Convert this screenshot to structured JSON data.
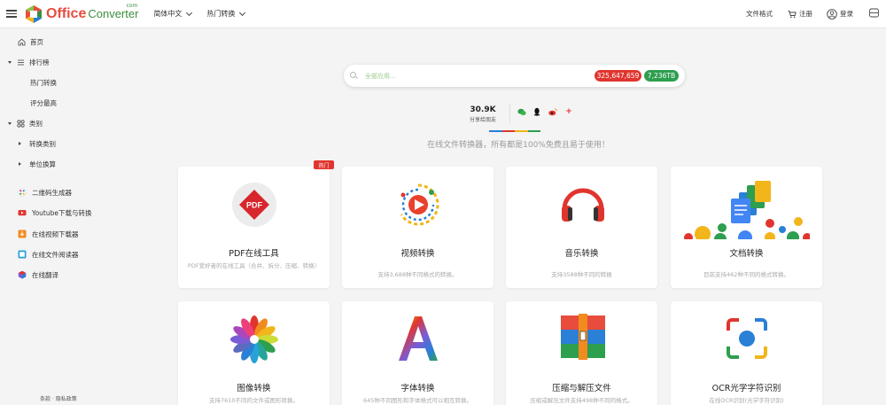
{
  "header": {
    "logo_office": "Office",
    "logo_converter": "Converter",
    "logo_com": "com",
    "language": "简体中文",
    "hot_convert": "热门转换",
    "file_formats": "文件格式",
    "register": "注册",
    "login": "登录"
  },
  "sidebar": {
    "home": "首页",
    "ranking": "排行榜",
    "hot_convert": "热门转换",
    "top_rated": "评分最高",
    "category": "类别",
    "convert_category": "转换类别",
    "unit_convert": "单位换算",
    "qr_generator": "二维码生成器",
    "youtube": "Youtube下载与转换",
    "video_downloader": "在线视频下载器",
    "file_reader": "在线文件阅读器",
    "translate": "在线翻译",
    "footer": "条款 · 隐私政策"
  },
  "search": {
    "placeholder": "全部应用...",
    "count_files": "325,647,659",
    "count_size": "7,236TB"
  },
  "share": {
    "count": "30.9K",
    "label": "分享给朋友",
    "plus": "+"
  },
  "tagline": "在线文件转换器，所有都是100%免费且易于使用！",
  "hot_badge": "热门",
  "cards": [
    {
      "title": "PDF在线工具",
      "desc": "PDF爱好者的在线工具（合并、拆分、压缩、转换）"
    },
    {
      "title": "视频转换",
      "desc": "支持3,688种不同格式的转换。"
    },
    {
      "title": "音乐转换",
      "desc": "支持3588种不同的转换"
    },
    {
      "title": "文档转换",
      "desc": "目前支持462种不同的格式转换。"
    },
    {
      "title": "图像转换",
      "desc": "支持7610不同的文件或图形转换。"
    },
    {
      "title": "字体转换",
      "desc": "645种不同图形和字体格式可以相互转换。"
    },
    {
      "title": "压缩与解压文件",
      "desc": "压缩或解压文件支持498种不同的格式。"
    },
    {
      "title": "OCR光学字符识别",
      "desc": "在线OCR识别(光学字符识别)"
    }
  ],
  "icons": {
    "pdf_label": "PDF"
  },
  "colors": {
    "accent_red": "#e0352e",
    "accent_green": "#2e9e4f",
    "brand_orange": "#e84c3d"
  }
}
